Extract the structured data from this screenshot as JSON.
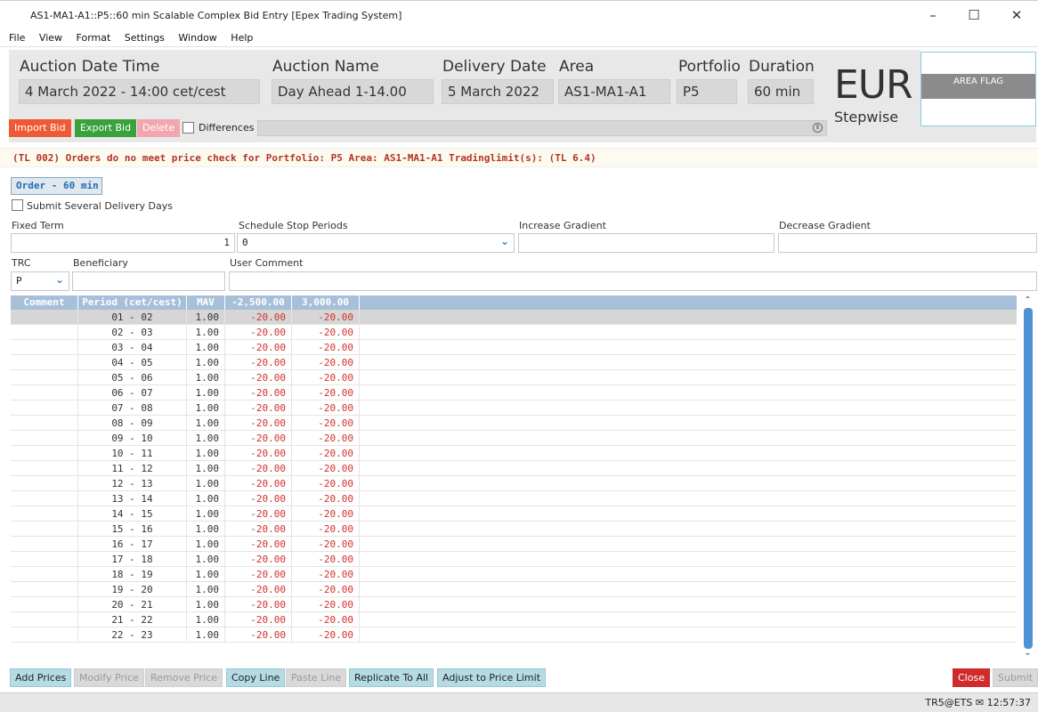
{
  "window": {
    "title": "AS1-MA1-A1::P5::60 min Scalable Complex Bid Entry [Epex Trading System]",
    "minimize": "–",
    "maximize": "☐",
    "close": "✕"
  },
  "menu": [
    "File",
    "View",
    "Format",
    "Settings",
    "Window",
    "Help"
  ],
  "header": {
    "auction_date_time": {
      "label": "Auction Date Time",
      "value": "4 March 2022 - 14:00 cet/cest"
    },
    "auction_name": {
      "label": "Auction Name",
      "value": "Day Ahead 1-14.00"
    },
    "delivery_date": {
      "label": "Delivery Date",
      "value": "5 March 2022"
    },
    "area": {
      "label": "Area",
      "value": "AS1-MA1-A1"
    },
    "portfolio": {
      "label": "Portfolio",
      "value": "P5"
    },
    "duration": {
      "label": "Duration",
      "value": "60 min"
    },
    "currency": "EUR",
    "bid_type": "Stepwise",
    "area_flag": "AREA FLAG"
  },
  "toolbar": {
    "import_bid": "Import Bid",
    "export_bid": "Export Bid",
    "delete": "Delete",
    "differences": "Differences"
  },
  "warning": "(TL 002) Orders do no meet price check for Portfolio: P5 Area: AS1-MA1-A1 Tradinglimit(s): (TL 6.4)",
  "order_tab": "Order - 60 min",
  "submit_several": "Submit Several Delivery Days",
  "form": {
    "fixed_term_label": "Fixed Term",
    "fixed_term_value": "1",
    "schedule_stop_label": "Schedule Stop Periods",
    "schedule_stop_value": "0",
    "increase_gradient_label": "Increase Gradient",
    "decrease_gradient_label": "Decrease Gradient",
    "trc_label": "TRC",
    "trc_value": "P",
    "beneficiary_label": "Beneficiary",
    "user_comment_label": "User Comment"
  },
  "grid": {
    "columns": [
      "Comment",
      "Period (cet/cest)",
      "MAV",
      "-2,500.00",
      "3,000.00"
    ],
    "rows": [
      {
        "period": "01 - 02",
        "mav": "1.00",
        "p1": "-20.00",
        "p2": "-20.00"
      },
      {
        "period": "02 - 03",
        "mav": "1.00",
        "p1": "-20.00",
        "p2": "-20.00"
      },
      {
        "period": "03 - 04",
        "mav": "1.00",
        "p1": "-20.00",
        "p2": "-20.00"
      },
      {
        "period": "04 - 05",
        "mav": "1.00",
        "p1": "-20.00",
        "p2": "-20.00"
      },
      {
        "period": "05 - 06",
        "mav": "1.00",
        "p1": "-20.00",
        "p2": "-20.00"
      },
      {
        "period": "06 - 07",
        "mav": "1.00",
        "p1": "-20.00",
        "p2": "-20.00"
      },
      {
        "period": "07 - 08",
        "mav": "1.00",
        "p1": "-20.00",
        "p2": "-20.00"
      },
      {
        "period": "08 - 09",
        "mav": "1.00",
        "p1": "-20.00",
        "p2": "-20.00"
      },
      {
        "period": "09 - 10",
        "mav": "1.00",
        "p1": "-20.00",
        "p2": "-20.00"
      },
      {
        "period": "10 - 11",
        "mav": "1.00",
        "p1": "-20.00",
        "p2": "-20.00"
      },
      {
        "period": "11 - 12",
        "mav": "1.00",
        "p1": "-20.00",
        "p2": "-20.00"
      },
      {
        "period": "12 - 13",
        "mav": "1.00",
        "p1": "-20.00",
        "p2": "-20.00"
      },
      {
        "period": "13 - 14",
        "mav": "1.00",
        "p1": "-20.00",
        "p2": "-20.00"
      },
      {
        "period": "14 - 15",
        "mav": "1.00",
        "p1": "-20.00",
        "p2": "-20.00"
      },
      {
        "period": "15 - 16",
        "mav": "1.00",
        "p1": "-20.00",
        "p2": "-20.00"
      },
      {
        "period": "16 - 17",
        "mav": "1.00",
        "p1": "-20.00",
        "p2": "-20.00"
      },
      {
        "period": "17 - 18",
        "mav": "1.00",
        "p1": "-20.00",
        "p2": "-20.00"
      },
      {
        "period": "18 - 19",
        "mav": "1.00",
        "p1": "-20.00",
        "p2": "-20.00"
      },
      {
        "period": "19 - 20",
        "mav": "1.00",
        "p1": "-20.00",
        "p2": "-20.00"
      },
      {
        "period": "20 - 21",
        "mav": "1.00",
        "p1": "-20.00",
        "p2": "-20.00"
      },
      {
        "period": "21 - 22",
        "mav": "1.00",
        "p1": "-20.00",
        "p2": "-20.00"
      },
      {
        "period": "22 - 23",
        "mav": "1.00",
        "p1": "-20.00",
        "p2": "-20.00"
      }
    ]
  },
  "bottom_buttons": {
    "add_prices": "Add Prices",
    "modify_price": "Modify Price",
    "remove_price": "Remove Price",
    "copy_line": "Copy Line",
    "paste_line": "Paste Line",
    "replicate_to_all": "Replicate To All",
    "adjust_to_price_limit": "Adjust to Price Limit",
    "close": "Close",
    "submit": "Submit"
  },
  "status": {
    "user": "TR5@ETS",
    "time": "12:57:37"
  },
  "colors": {
    "accent_blue": "#256cae",
    "grid_header": "#a8bfda",
    "negative_price": "#d03030",
    "close_button": "#cf2b2b"
  }
}
